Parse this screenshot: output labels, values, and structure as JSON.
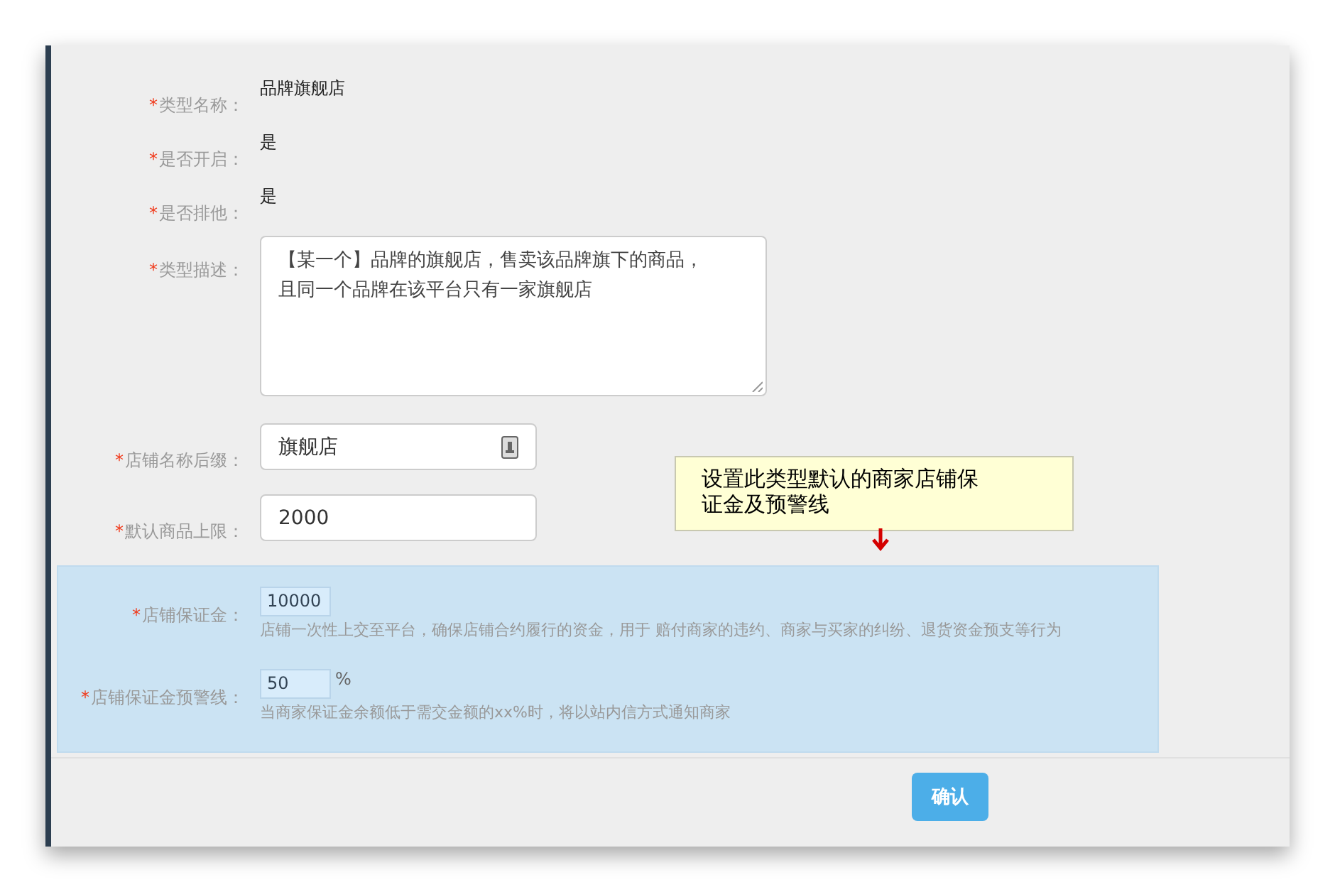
{
  "required_mark": "*",
  "fields": [
    {
      "kind": "text",
      "label": "类型名称：",
      "required": true,
      "value": "品牌旗舰店"
    },
    {
      "kind": "text",
      "label": "是否开启：",
      "required": true,
      "value": "是"
    },
    {
      "kind": "text",
      "label": "是否排他：",
      "required": true,
      "value": "是"
    },
    {
      "kind": "textarea",
      "label": "类型描述：",
      "required": true,
      "value": "【某一个】品牌的旗舰店，售卖该品牌旗下的商品，且同一个品牌在该平台只有一家旗舰店"
    },
    {
      "kind": "input",
      "label": "店铺名称后缀：",
      "required": true,
      "value": "旗舰店",
      "icon": true
    },
    {
      "kind": "input",
      "label": "默认商品上限：",
      "required": true,
      "value": "2000",
      "icon": false
    }
  ],
  "deposit_section": {
    "highlighted": true,
    "fields": [
      {
        "label": "店铺保证金：",
        "required": true,
        "value": "10000",
        "hint": "店铺一次性上交至平台，确保店铺合约履行的资金，用于 赔付商家的违约、商家与买家的纠纷、退货资金预支等行为"
      },
      {
        "label": "店铺保证金预警线：",
        "required": true,
        "value": "50",
        "suffix": "%",
        "hint": "当商家保证金余额低于需交金额的xx%时，将以站内信方式通知商家"
      }
    ]
  },
  "callout": {
    "text": "设置此类型默认的商家店铺保证金及预警线"
  },
  "confirm_button": "确认"
}
